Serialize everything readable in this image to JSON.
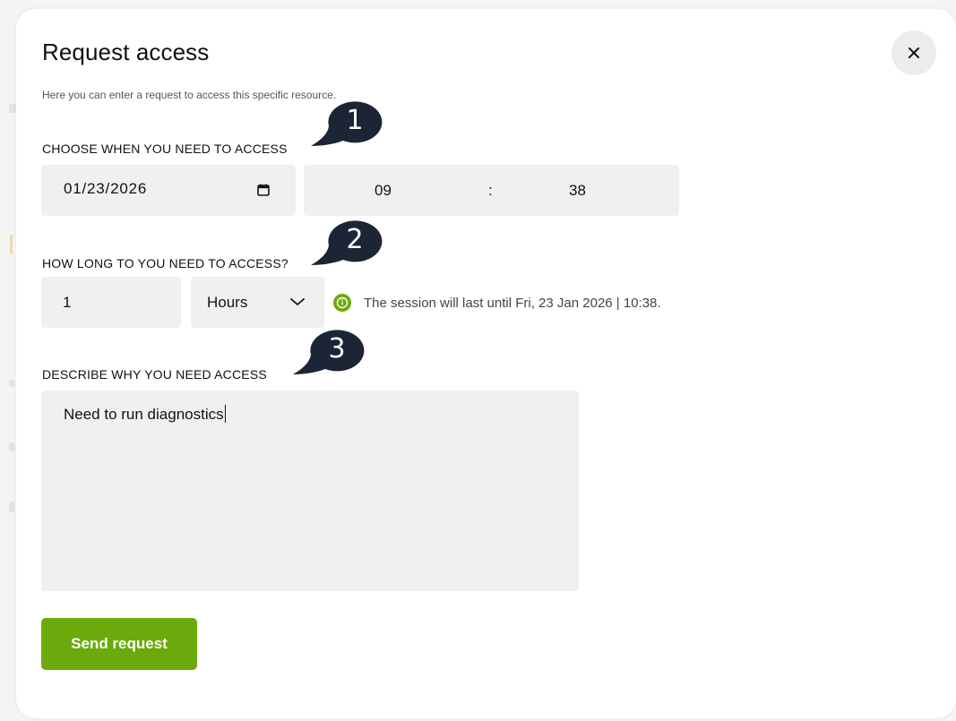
{
  "dialog": {
    "title": "Request access",
    "subtitle": "Here you can enter a request to access this specific resource.",
    "close_icon": "close-icon"
  },
  "access_time": {
    "label": "CHOOSE WHEN YOU NEED TO ACCESS",
    "date_value": "01/23/2026",
    "date_icon": "calendar-icon",
    "hour": "09",
    "separator": ":",
    "minute": "38"
  },
  "duration": {
    "label": "HOW LONG TO YOU NEED TO ACCESS?",
    "amount": "1",
    "unit_selected": "Hours",
    "unit_icon": "chevron-down-icon",
    "info_icon": "info-icon",
    "session_info": "The session will last until Fri, 23 Jan 2026 | 10:38."
  },
  "reason": {
    "label": "DESCRIBE WHY YOU NEED ACCESS",
    "value": "Need to run diagnostics"
  },
  "actions": {
    "send_label": "Send request"
  },
  "steps": [
    {
      "number": "1"
    },
    {
      "number": "2"
    },
    {
      "number": "3"
    }
  ],
  "colors": {
    "accent_green": "#6aaa0a",
    "badge_navy": "#1c2535",
    "field_bg": "#f0f0f0"
  }
}
